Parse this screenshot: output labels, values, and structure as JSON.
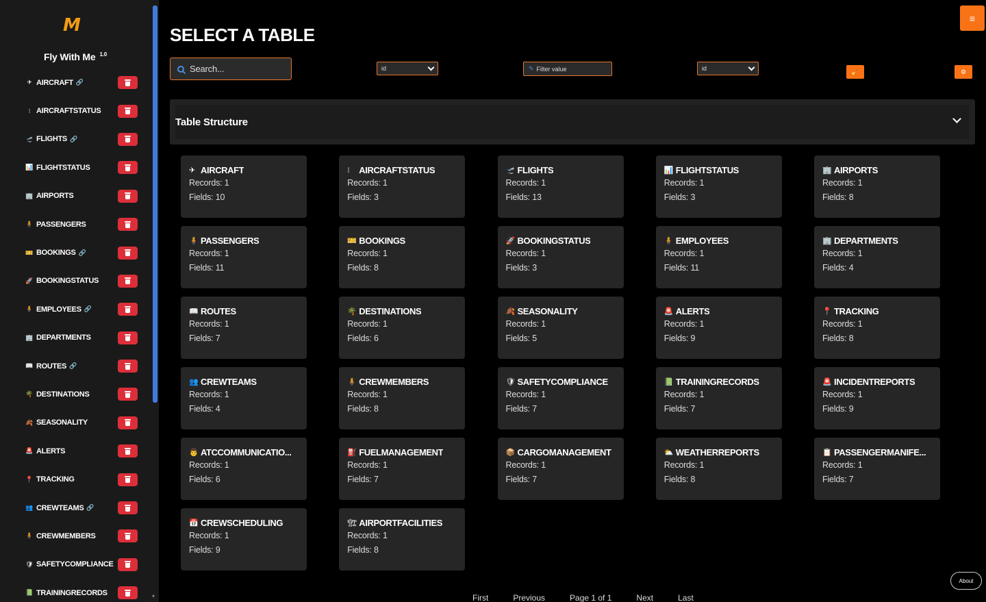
{
  "app": {
    "logo": "M",
    "title": "Fly With Me",
    "version": "1.0"
  },
  "sidebar": {
    "items": [
      {
        "icon": "✈",
        "label": "AIRCRAFT",
        "linked": true
      },
      {
        "icon": "⁝",
        "label": "AIRCRAFTSTATUS",
        "linked": false
      },
      {
        "icon": "🛫",
        "label": "FLIGHTS",
        "linked": true
      },
      {
        "icon": "📊",
        "label": "FLIGHTSTATUS",
        "linked": false
      },
      {
        "icon": "🏢",
        "label": "AIRPORTS",
        "linked": false
      },
      {
        "icon": "🧍",
        "label": "PASSENGERS",
        "linked": false
      },
      {
        "icon": "🎫",
        "label": "BOOKINGS",
        "linked": true
      },
      {
        "icon": "🚀",
        "label": "BOOKINGSTATUS",
        "linked": false
      },
      {
        "icon": "🧍",
        "label": "EMPLOYEES",
        "linked": true
      },
      {
        "icon": "🏢",
        "label": "DEPARTMENTS",
        "linked": false
      },
      {
        "icon": "📖",
        "label": "ROUTES",
        "linked": true
      },
      {
        "icon": "🌴",
        "label": "DESTINATIONS",
        "linked": false
      },
      {
        "icon": "🍂",
        "label": "SEASONALITY",
        "linked": false
      },
      {
        "icon": "🚨",
        "label": "ALERTS",
        "linked": false
      },
      {
        "icon": "📍",
        "label": "TRACKING",
        "linked": false
      },
      {
        "icon": "👥",
        "label": "CREWTEAMS",
        "linked": true
      },
      {
        "icon": "🧍",
        "label": "CREWMEMBERS",
        "linked": false
      },
      {
        "icon": "🛡",
        "label": "SAFETYCOMPLIANCE",
        "linked": false
      },
      {
        "icon": "📗",
        "label": "TRAININGRECORDS",
        "linked": false
      }
    ],
    "link_glyph": "🔗"
  },
  "main": {
    "title": "SELECT A TABLE",
    "search_placeholder": "Search...",
    "field_select_1": "id",
    "filter_placeholder": "Filter value",
    "field_select_2": "id",
    "menu_glyph": "≡",
    "panel_title": "Table Structure",
    "about_label": "About",
    "pager": [
      "First",
      "Previous",
      "Page 1 of 1",
      "Next",
      "Last"
    ]
  },
  "tables": [
    {
      "icon": "✈",
      "name": "AIRCRAFT",
      "records": "Records: 1",
      "fields": "Fields: 10"
    },
    {
      "icon": "⁝",
      "name": "AIRCRAFTSTATUS",
      "records": "Records: 1",
      "fields": "Fields: 3"
    },
    {
      "icon": "🛫",
      "name": "FLIGHTS",
      "records": "Records: 1",
      "fields": "Fields: 13"
    },
    {
      "icon": "📊",
      "name": "FLIGHTSTATUS",
      "records": "Records: 1",
      "fields": "Fields: 3"
    },
    {
      "icon": "🏢",
      "name": "AIRPORTS",
      "records": "Records: 1",
      "fields": "Fields: 8"
    },
    {
      "icon": "🧍",
      "name": "PASSENGERS",
      "records": "Records: 1",
      "fields": "Fields: 11"
    },
    {
      "icon": "🎫",
      "name": "BOOKINGS",
      "records": "Records: 1",
      "fields": "Fields: 8"
    },
    {
      "icon": "🚀",
      "name": "BOOKINGSTATUS",
      "records": "Records: 1",
      "fields": "Fields: 3"
    },
    {
      "icon": "🧍",
      "name": "EMPLOYEES",
      "records": "Records: 1",
      "fields": "Fields: 11"
    },
    {
      "icon": "🏢",
      "name": "DEPARTMENTS",
      "records": "Records: 1",
      "fields": "Fields: 4"
    },
    {
      "icon": "📖",
      "name": "ROUTES",
      "records": "Records: 1",
      "fields": "Fields: 7"
    },
    {
      "icon": "🌴",
      "name": "DESTINATIONS",
      "records": "Records: 1",
      "fields": "Fields: 6"
    },
    {
      "icon": "🍂",
      "name": "SEASONALITY",
      "records": "Records: 1",
      "fields": "Fields: 5"
    },
    {
      "icon": "🚨",
      "name": "ALERTS",
      "records": "Records: 1",
      "fields": "Fields: 9"
    },
    {
      "icon": "📍",
      "name": "TRACKING",
      "records": "Records: 1",
      "fields": "Fields: 8"
    },
    {
      "icon": "👥",
      "name": "CREWTEAMS",
      "records": "Records: 1",
      "fields": "Fields: 4"
    },
    {
      "icon": "🧍",
      "name": "CREWMEMBERS",
      "records": "Records: 1",
      "fields": "Fields: 8"
    },
    {
      "icon": "🛡",
      "name": "SAFETYCOMPLIANCE",
      "records": "Records: 1",
      "fields": "Fields: 7"
    },
    {
      "icon": "📗",
      "name": "TRAININGRECORDS",
      "records": "Records: 1",
      "fields": "Fields: 7"
    },
    {
      "icon": "🚨",
      "name": "INCIDENTREPORTS",
      "records": "Records: 1",
      "fields": "Fields: 9"
    },
    {
      "icon": "👨",
      "name": "ATCCOMMUNICATIO...",
      "records": "Records: 1",
      "fields": "Fields: 6"
    },
    {
      "icon": "⛽",
      "name": "FUELMANAGEMENT",
      "records": "Records: 1",
      "fields": "Fields: 7"
    },
    {
      "icon": "📦",
      "name": "CARGOMANAGEMENT",
      "records": "Records: 1",
      "fields": "Fields: 7"
    },
    {
      "icon": "⛅",
      "name": "WEATHERREPORTS",
      "records": "Records: 1",
      "fields": "Fields: 8"
    },
    {
      "icon": "📋",
      "name": "PASSENGERMANIFE...",
      "records": "Records: 1",
      "fields": "Fields: 7"
    },
    {
      "icon": "📅",
      "name": "CREWSCHEDULING",
      "records": "Records: 1",
      "fields": "Fields: 9"
    },
    {
      "icon": "🏗",
      "name": "AIRPORTFACILITIES",
      "records": "Records: 1",
      "fields": "Fields: 8"
    }
  ],
  "colors": {
    "accent": "#f97316",
    "danger": "#dc2f3a",
    "scrollbar": "#3f7be0"
  }
}
